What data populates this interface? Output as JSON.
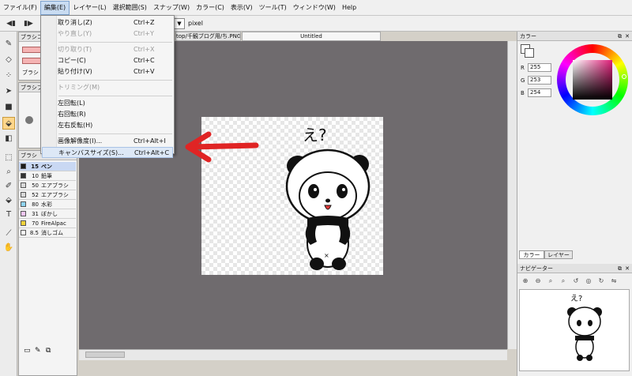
{
  "menubar": {
    "items": [
      "ファイル(F)",
      "編集(E)",
      "レイヤー(L)",
      "選択範囲(S)",
      "スナップ(W)",
      "カラー(C)",
      "表示(V)",
      "ツール(T)",
      "ウィンドウ(W)",
      "Help"
    ]
  },
  "toolbar": {
    "unit_label": "pixel",
    "unit_arrow": "▼"
  },
  "panels": {
    "brush_control_title": "ブラシコン",
    "brush_tab": "ブラシ",
    "brush_preview_title": "ブラシプレ",
    "brush_list_title": "ブラシ",
    "brushes": [
      {
        "size": "15",
        "name": "ペン",
        "color": "#1a1a1a",
        "selected": true
      },
      {
        "size": "10",
        "name": "鉛筆",
        "color": "#333333",
        "selected": false
      },
      {
        "size": "50",
        "name": "エアブラシ",
        "color": "#d8d8d8",
        "selected": false
      },
      {
        "size": "52",
        "name": "エアブラシ",
        "color": "#d8d8d8",
        "selected": false
      },
      {
        "size": "80",
        "name": "水彩",
        "color": "#8fd3f0",
        "selected": false
      },
      {
        "size": "31",
        "name": "ぼかし",
        "color": "#f1c6f5",
        "selected": false
      },
      {
        "size": "70",
        "name": "FireAlpac",
        "color": "#f0d23a",
        "selected": false
      },
      {
        "size": "8.5",
        "name": "消しゴム",
        "color": "#ffffff",
        "selected": false
      }
    ]
  },
  "tabs": {
    "file_tab": "top/千観ブログ用/ち.PNG",
    "untitled_tab": "Untitled"
  },
  "color_panel": {
    "title": "カラー",
    "r_label": "R",
    "r": "255",
    "g_label": "G",
    "g": "253",
    "b_label": "B",
    "b": "254",
    "selected_color": "#fffdfe"
  },
  "right_tabs": {
    "color": "カラー",
    "layer": "レイヤー"
  },
  "navigator": {
    "title": "ナビゲーター"
  },
  "canvas": {
    "doodle_text": "え?"
  },
  "edit_menu": {
    "items": [
      {
        "label": "取り消し(Z)",
        "shortcut": "Ctrl+Z",
        "disabled": false
      },
      {
        "label": "やり直し(Y)",
        "shortcut": "Ctrl+Y",
        "disabled": true
      },
      {
        "sep": true
      },
      {
        "label": "切り取り(T)",
        "shortcut": "Ctrl+X",
        "disabled": true
      },
      {
        "label": "コピー(C)",
        "shortcut": "Ctrl+C",
        "disabled": false
      },
      {
        "label": "貼り付け(V)",
        "shortcut": "Ctrl+V",
        "disabled": false
      },
      {
        "sep": true
      },
      {
        "label": "トリミング(M)",
        "shortcut": "",
        "disabled": true
      },
      {
        "sep": true
      },
      {
        "label": "左回転(L)",
        "shortcut": "",
        "disabled": false
      },
      {
        "label": "右回転(R)",
        "shortcut": "",
        "disabled": false
      },
      {
        "label": "左右反転(H)",
        "shortcut": "",
        "disabled": false
      },
      {
        "sep": true
      },
      {
        "label": "画像解像度(I)...",
        "shortcut": "Ctrl+Alt+I",
        "disabled": false
      },
      {
        "label": "キャンバスサイズ(S)...",
        "shortcut": "Ctrl+Alt+C",
        "disabled": false,
        "highlighted": true
      }
    ]
  },
  "colors": {
    "accent_arrow": "#e02424",
    "workspace": "#6f6b6e"
  }
}
